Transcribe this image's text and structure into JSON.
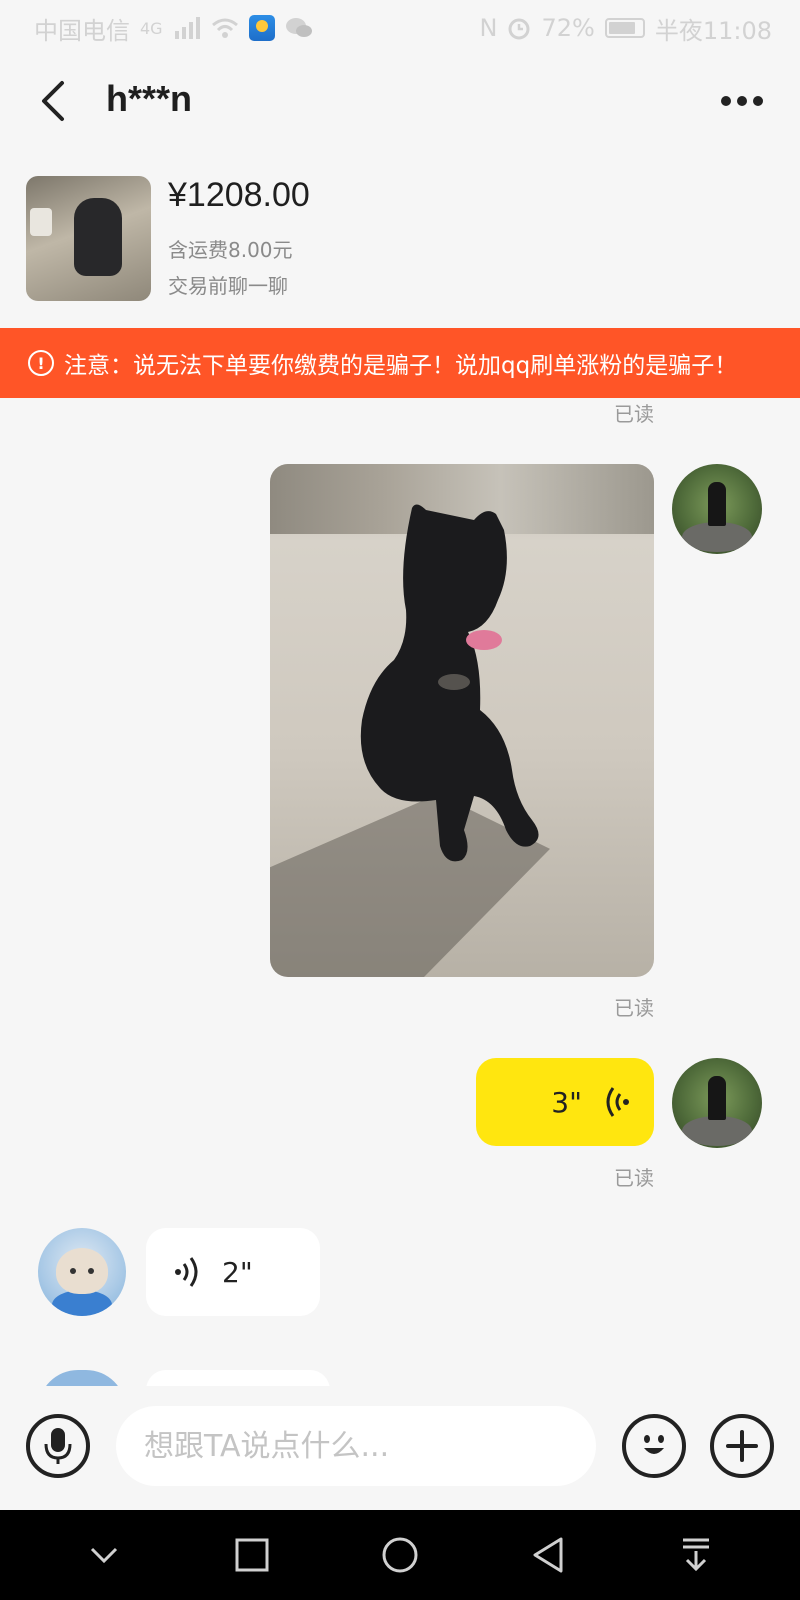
{
  "status_bar": {
    "carrier": "中国电信",
    "signal_label": "4G",
    "nfc": "N",
    "battery": "72%",
    "time": "半夜11:08"
  },
  "header": {
    "title": "h***n"
  },
  "product": {
    "price": "¥1208.00",
    "shipping": "含运费8.00元",
    "subtitle": "交易前聊一聊"
  },
  "warning": {
    "icon_text": "!",
    "text": "注意：说无法下单要你缴费的是骗子！说加qq刷单涨粉的是骗子！"
  },
  "messages": {
    "read_label": "已读",
    "voice_me_duration": "3\"",
    "voice_other_duration": "2\""
  },
  "input": {
    "placeholder": "想跟TA说点什么..."
  },
  "colors": {
    "warning_bg": "#ff5527",
    "my_bubble": "#ffe60f",
    "background": "#f6f6f6"
  },
  "icons": [
    "back-arrow",
    "more-dots",
    "microphone",
    "emoji",
    "plus",
    "voice-wave",
    "nav-down",
    "nav-square",
    "nav-circle",
    "nav-triangle",
    "nav-notification"
  ]
}
